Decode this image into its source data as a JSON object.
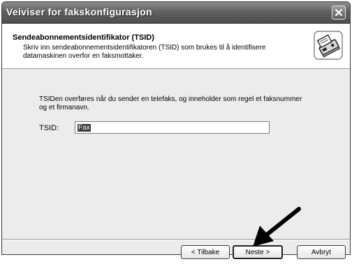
{
  "window": {
    "title": "Veiviser for fakskonfigurasjon"
  },
  "header": {
    "title": "Sendeabonnementsidentifikator (TSID)",
    "description": "Skriv inn sendeabonnementsidentifikatoren (TSID) som brukes til å identifisere datamaskinen overfor en faksmottaker.",
    "icon": "fax-machine-icon"
  },
  "body": {
    "info": "TSIDen overføres når du sender en telefaks, og inneholder som regel et faksnummer og et firmanavn.",
    "tsid_label": "TSID:",
    "tsid_value": "Fax"
  },
  "buttons": {
    "back": "< Tilbake",
    "next": "Neste >",
    "cancel": "Avbryt"
  },
  "annotation": {
    "icon": "pointer-arrow-icon"
  }
}
